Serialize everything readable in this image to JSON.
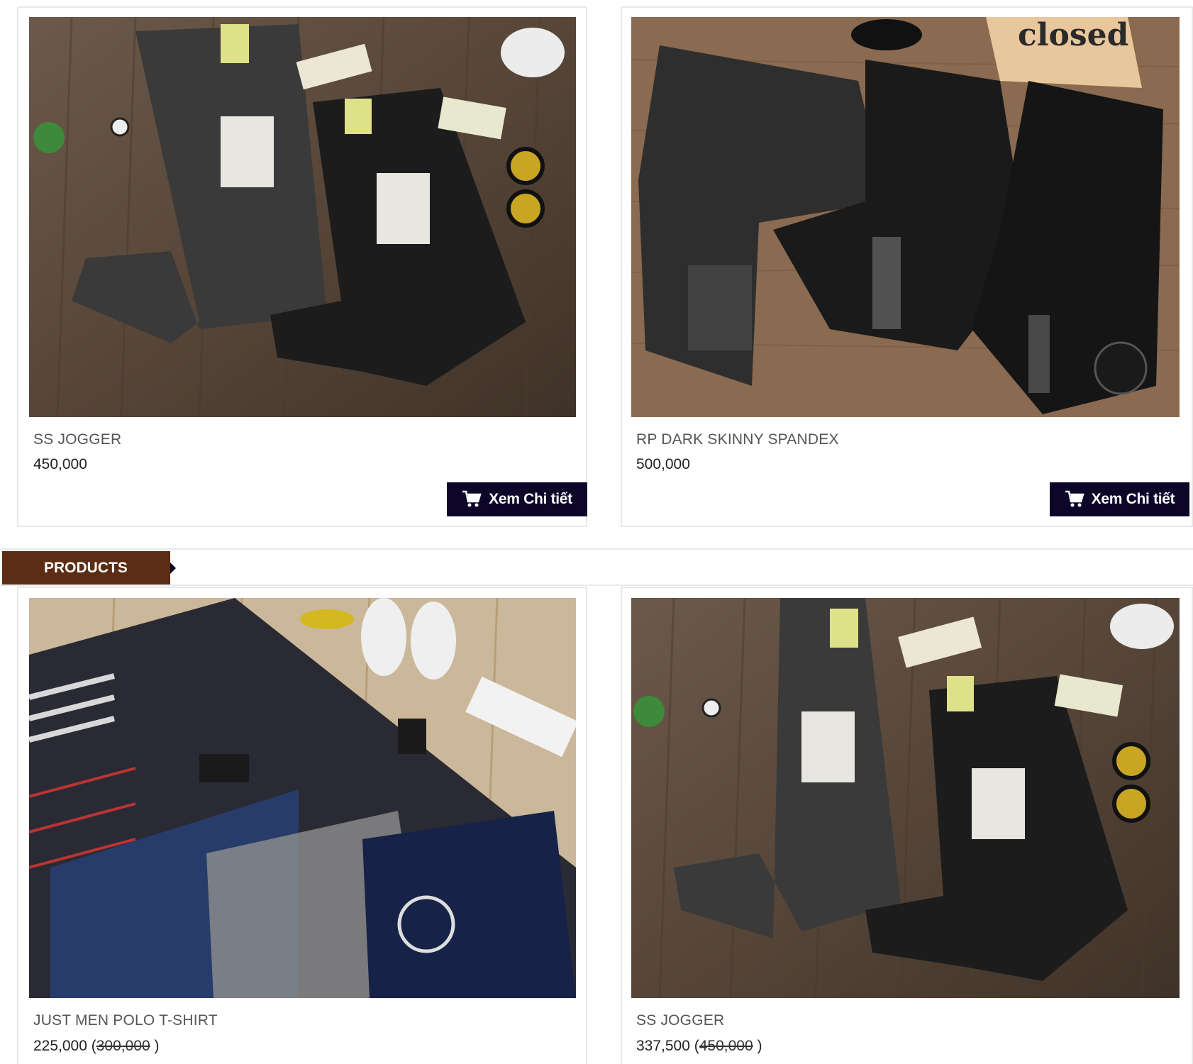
{
  "section": {
    "label": "PRODUCTS"
  },
  "products": [
    {
      "name": "SS JOGGER",
      "price": "450,000",
      "button_label": "Xem Chi tiết"
    },
    {
      "name": "RP DARK SKINNY SPANDEX",
      "price": "500,000",
      "button_label": "Xem Chi tiết"
    },
    {
      "name": "JUST MEN POLO T-SHIRT",
      "price": "225,000",
      "old_price": "300,000",
      "paren_open": " (",
      "paren_close": " )"
    },
    {
      "name": "SS JOGGER",
      "price": "337,500",
      "old_price": "450,000",
      "paren_open": " (",
      "paren_close": " )"
    }
  ],
  "colors": {
    "button_bg": "#0d0628",
    "section_tab_bg": "#5a2d14"
  },
  "icons": [
    "cart-icon"
  ],
  "images": [
    "jogger-pants-on-wood-floor",
    "dark-skinny-jeans-on-burlap",
    "polo-shirts-on-wood-floor",
    "jogger-pants-on-wood-floor"
  ]
}
